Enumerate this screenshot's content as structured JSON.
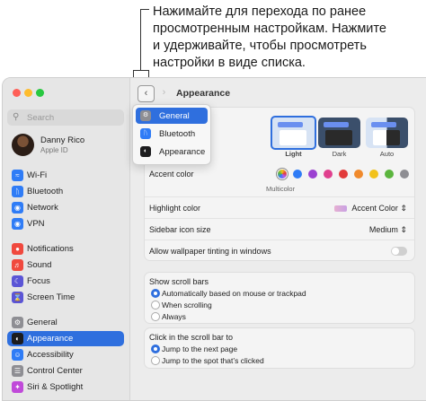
{
  "callout": {
    "line1": "Нажимайте для перехода по ранее",
    "line2": "просмотренным настройкам. Нажмите",
    "line3": "и удерживайте, чтобы просмотреть",
    "line4": "настройки в виде списка."
  },
  "sidebar": {
    "search_placeholder": "Search",
    "profile": {
      "name": "Danny Rico",
      "sub": "Apple ID"
    },
    "items": [
      {
        "label": "Wi-Fi",
        "icon": "wifi-icon",
        "color": "#2f7cf6"
      },
      {
        "label": "Bluetooth",
        "icon": "bluetooth-icon",
        "color": "#2f7cf6"
      },
      {
        "label": "Network",
        "icon": "globe-icon",
        "color": "#2f7cf6"
      },
      {
        "label": "VPN",
        "icon": "globe-icon",
        "color": "#2f7cf6"
      },
      {
        "label": "Notifications",
        "icon": "bell-icon",
        "color": "#f0493e"
      },
      {
        "label": "Sound",
        "icon": "speaker-icon",
        "color": "#f0493e"
      },
      {
        "label": "Focus",
        "icon": "moon-icon",
        "color": "#5b55d6"
      },
      {
        "label": "Screen Time",
        "icon": "hourglass-icon",
        "color": "#5b55d6"
      },
      {
        "label": "General",
        "icon": "gear-icon",
        "color": "#8e8e93"
      },
      {
        "label": "Appearance",
        "icon": "appearance-icon",
        "color": "#1c1c1e"
      },
      {
        "label": "Accessibility",
        "icon": "accessibility-icon",
        "color": "#2f7cf6"
      },
      {
        "label": "Control Center",
        "icon": "control-center-icon",
        "color": "#8e8e93"
      },
      {
        "label": "Siri & Spotlight",
        "icon": "siri-icon",
        "color": "#c04ad9"
      }
    ]
  },
  "header": {
    "title": "Appearance"
  },
  "nav_menu": {
    "items": [
      {
        "label": "General",
        "icon": "gear-icon"
      },
      {
        "label": "Bluetooth",
        "icon": "bluetooth-icon"
      },
      {
        "label": "Appearance",
        "icon": "appearance-icon"
      }
    ]
  },
  "appearance": {
    "options": [
      "Light",
      "Dark",
      "Auto"
    ],
    "selected": "Light"
  },
  "accent": {
    "label": "Accent color",
    "selected_label": "Multicolor",
    "colors": [
      "#b05cf0",
      "#2f7cf6",
      "#9b41d1",
      "#e0408e",
      "#e23b3b",
      "#f08a2c",
      "#f2c21b",
      "#5bb53e",
      "#8e8e93"
    ]
  },
  "settings": {
    "highlight_label": "Highlight color",
    "highlight_value": "Accent Color",
    "sidebar_icon_label": "Sidebar icon size",
    "sidebar_icon_value": "Medium",
    "tinting_label": "Allow wallpaper tinting in windows"
  },
  "scrollbars": {
    "title": "Show scroll bars",
    "options": [
      "Automatically based on mouse or trackpad",
      "When scrolling",
      "Always"
    ]
  },
  "clickscroll": {
    "title": "Click in the scroll bar to",
    "options": [
      "Jump to the next page",
      "Jump to the spot that’s clicked"
    ]
  }
}
